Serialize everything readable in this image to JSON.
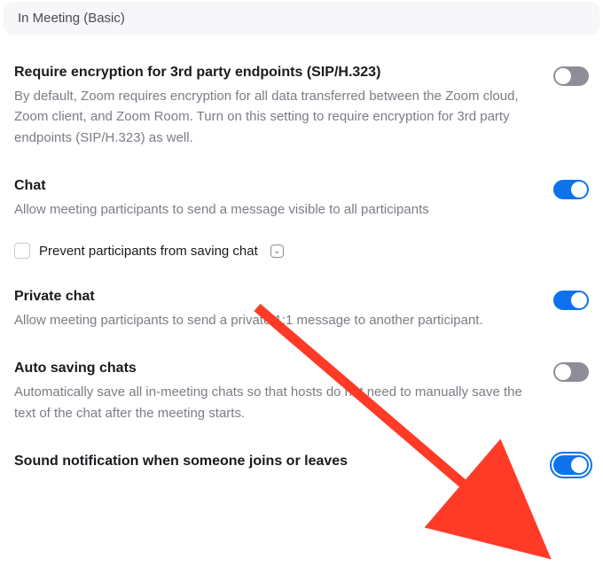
{
  "section_header": "In Meeting (Basic)",
  "settings": [
    {
      "title": "Require encryption for 3rd party endpoints (SIP/H.323)",
      "desc": "By default, Zoom requires encryption for all data transferred between the Zoom cloud, Zoom client, and Zoom Room. Turn on this setting to require encryption for 3rd party endpoints (SIP/H.323) as well.",
      "enabled": false
    },
    {
      "title": "Chat",
      "desc": "Allow meeting participants to send a message visible to all participants",
      "enabled": true,
      "sub": {
        "label": "Prevent participants from saving chat",
        "checked": false,
        "help_glyph": "⌄"
      }
    },
    {
      "title": "Private chat",
      "desc": "Allow meeting participants to send a private 1:1 message to another participant.",
      "enabled": true
    },
    {
      "title": "Auto saving chats",
      "desc": "Automatically save all in-meeting chats so that hosts do not need to manually save the text of the chat after the meeting starts.",
      "enabled": false
    },
    {
      "title": "Sound notification when someone joins or leaves",
      "desc": "",
      "enabled": true,
      "focused": true
    }
  ],
  "annotation": {
    "color": "#ff3b27"
  }
}
